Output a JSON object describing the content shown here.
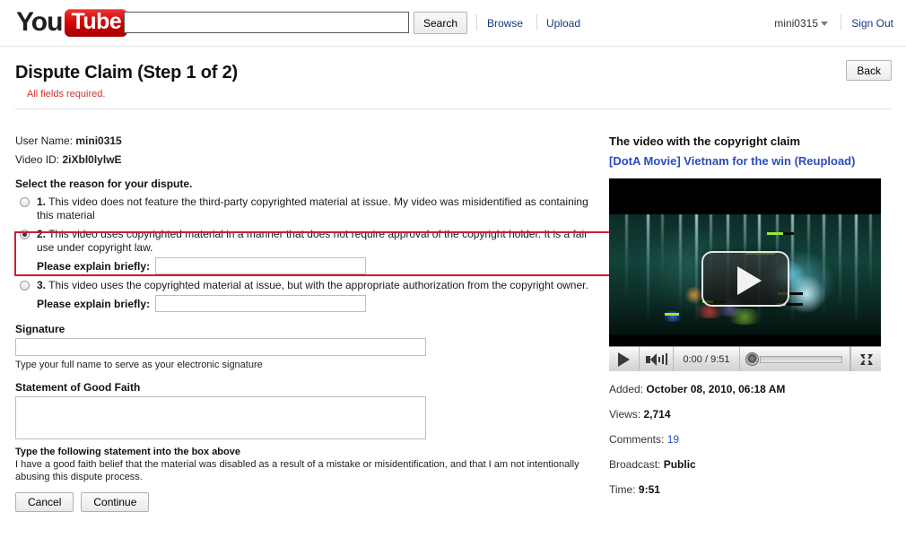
{
  "header": {
    "logo_you": "You",
    "logo_tube": "Tube",
    "search_value": "",
    "search_placeholder": "",
    "search_button": "Search",
    "browse_link": "Browse",
    "upload_link": "Upload",
    "account_name": "mini0315",
    "sign_out": "Sign Out"
  },
  "page": {
    "title": "Dispute Claim (Step 1 of 2)",
    "required_note": "All fields required.",
    "back_button": "Back",
    "required_color": "#cc3333",
    "highlight_color": "#cc1f2a"
  },
  "form": {
    "user_name_label": "User Name:",
    "user_name_value": "mini0315",
    "video_id_label": "Video ID:",
    "video_id_value": "2iXbl0lylwE",
    "reason_heading": "Select the reason for your dispute.",
    "options": [
      {
        "num": "1.",
        "text": "This video does not feature the third-party copyrighted material at issue. My video was misidentified as containing this material",
        "checked": false,
        "has_explain": false
      },
      {
        "num": "2.",
        "text": "This video uses copyrighted material in a manner that does not require approval of the copyright holder. It is a fair use under copyright law.",
        "checked": true,
        "has_explain": true,
        "explain_label": "Please explain briefly:",
        "explain_value": ""
      },
      {
        "num": "3.",
        "text": "This video uses the copyrighted material at issue, but with the appropriate authorization from the copyright owner.",
        "checked": false,
        "has_explain": true,
        "explain_label": "Please explain briefly:",
        "explain_value": ""
      }
    ],
    "signature_label": "Signature",
    "signature_value": "",
    "signature_hint": "Type your full name to serve as your electronic signature",
    "good_faith_label": "Statement of Good Faith",
    "good_faith_value": "",
    "good_faith_instruction": "Type the following statement into the box above",
    "good_faith_statement": "I have a good faith belief that the material was disabled as a result of a mistake or misidentification, and that I am not intentionally abusing this dispute process.",
    "cancel_button": "Cancel",
    "continue_button": "Continue"
  },
  "video": {
    "section_heading": "The video with the copyright claim",
    "title": "[DotA Movie] Vietnam for the win (Reupload)",
    "player": {
      "current_time": "0:00",
      "duration": "9:51",
      "time_display": "0:00 / 9:51"
    },
    "info": [
      {
        "label": "Added:",
        "value": "October 08, 2010, 06:18 AM",
        "link": false
      },
      {
        "label": "Views:",
        "value": "2,714",
        "link": false
      },
      {
        "label": "Comments:",
        "value": "19",
        "link": true
      },
      {
        "label": "Broadcast:",
        "value": "Public",
        "link": false
      },
      {
        "label": "Time:",
        "value": "9:51",
        "link": false
      }
    ]
  }
}
